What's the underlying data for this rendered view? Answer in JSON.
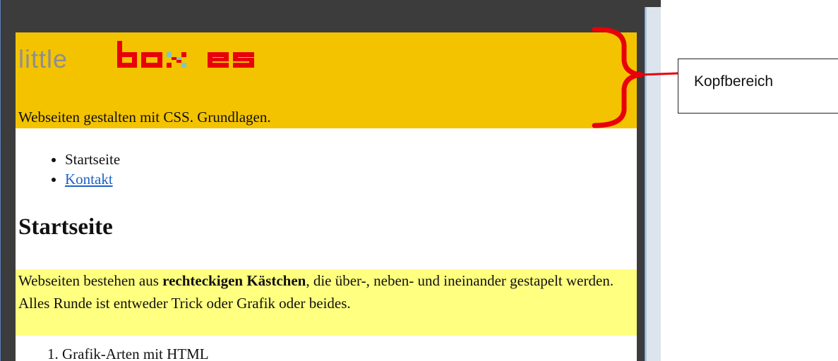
{
  "header": {
    "logo_part1": "little",
    "logo_part2": "boxes",
    "tagline": "Webseiten gestalten mit CSS. Grundlagen."
  },
  "nav": {
    "items": [
      {
        "label": "Startseite",
        "is_link": false
      },
      {
        "label": "Kontakt",
        "is_link": true
      }
    ]
  },
  "main": {
    "heading": "Startseite",
    "intro_before": "Webseiten bestehen aus ",
    "intro_bold": "rechteckigen Kästchen",
    "intro_after": ", die über-, neben- und ineinander gestapelt werden. Alles Runde ist entweder Trick oder Grafik oder beides.",
    "ordered_list_first": "Grafik-Arten mit HTML"
  },
  "annotation": {
    "label": "Kopfbereich",
    "bracket_color": "#e8000b"
  },
  "colors": {
    "header_bg": "#f4c300",
    "intro_bg": "#ffff80",
    "link": "#1c63c7"
  }
}
